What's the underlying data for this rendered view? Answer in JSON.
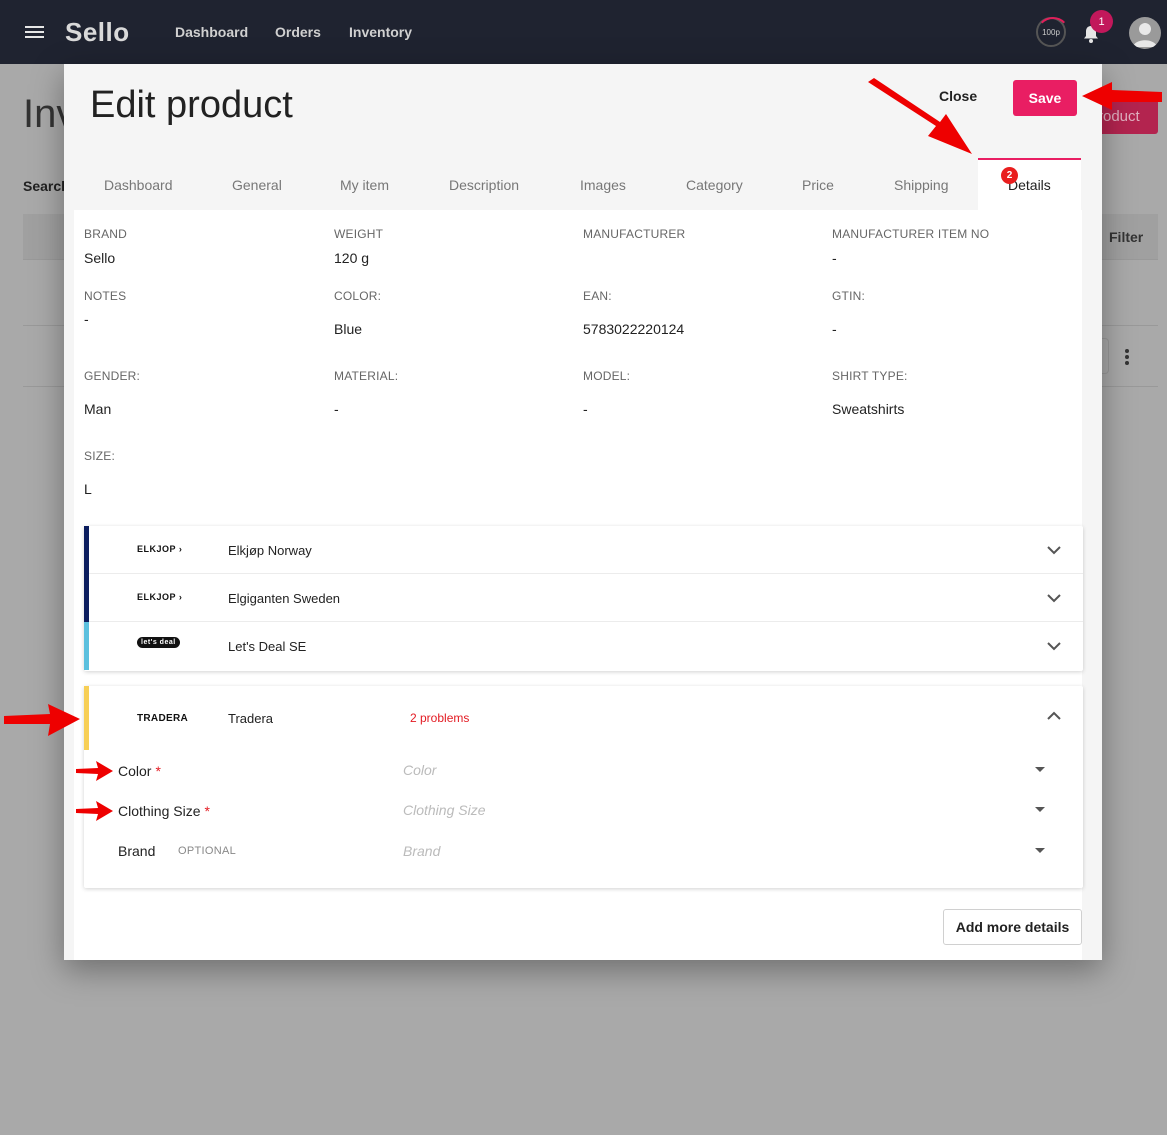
{
  "app": {
    "brand": "Sello",
    "nav": [
      "Dashboard",
      "Orders",
      "Inventory"
    ],
    "quota": "100p",
    "notifications": "1"
  },
  "background": {
    "title": "Inv",
    "search_label": "Search",
    "add_button": "roduct",
    "filter_label": "Filter"
  },
  "modal": {
    "title": "Edit product",
    "close_label": "Close",
    "save_label": "Save",
    "tabs": [
      "Dashboard",
      "General",
      "My item",
      "Description",
      "Images",
      "Category",
      "Price",
      "Shipping"
    ],
    "active_tab": {
      "label": "Details",
      "badge": "2"
    }
  },
  "details": {
    "brand": {
      "label": "BRAND",
      "value": "Sello"
    },
    "weight": {
      "label": "WEIGHT",
      "value": "120 g"
    },
    "manufacturer": {
      "label": "MANUFACTURER",
      "value": ""
    },
    "manufacturer_item_no": {
      "label": "MANUFACTURER ITEM NO",
      "value": "-"
    },
    "notes": {
      "label": "NOTES",
      "value": "-"
    },
    "color": {
      "label": "COLOR:",
      "value": "Blue"
    },
    "ean": {
      "label": "EAN:",
      "value": "5783022220124"
    },
    "gtin": {
      "label": "GTIN:",
      "value": "-"
    },
    "gender": {
      "label": "GENDER:",
      "value": "Man"
    },
    "material": {
      "label": "MATERIAL:",
      "value": "-"
    },
    "model": {
      "label": "MODEL:",
      "value": "-"
    },
    "shirt_type": {
      "label": "SHIRT TYPE:",
      "value": "Sweatshirts"
    },
    "size": {
      "label": "SIZE:",
      "value": "L"
    }
  },
  "channels": [
    {
      "logo": "ELKJOP",
      "name": "Elkjøp Norway",
      "color": "#0b1d5e"
    },
    {
      "logo": "ELKJOP",
      "name": "Elgiganten Sweden",
      "color": "#0b1d5e"
    },
    {
      "logo": "let's deal",
      "name": "Let's Deal SE",
      "color": "#5bc0de"
    }
  ],
  "tradera": {
    "logo": "TRADERA",
    "name": "Tradera",
    "problems": "2 problems",
    "color": "#f7cf56",
    "attributes": [
      {
        "label": "Color",
        "required": "*",
        "placeholder": "Color"
      },
      {
        "label": "Clothing Size",
        "required": "*",
        "placeholder": "Clothing Size"
      },
      {
        "label": "Brand",
        "optional": "OPTIONAL",
        "placeholder": "Brand"
      }
    ]
  },
  "add_more_label": "Add more details"
}
